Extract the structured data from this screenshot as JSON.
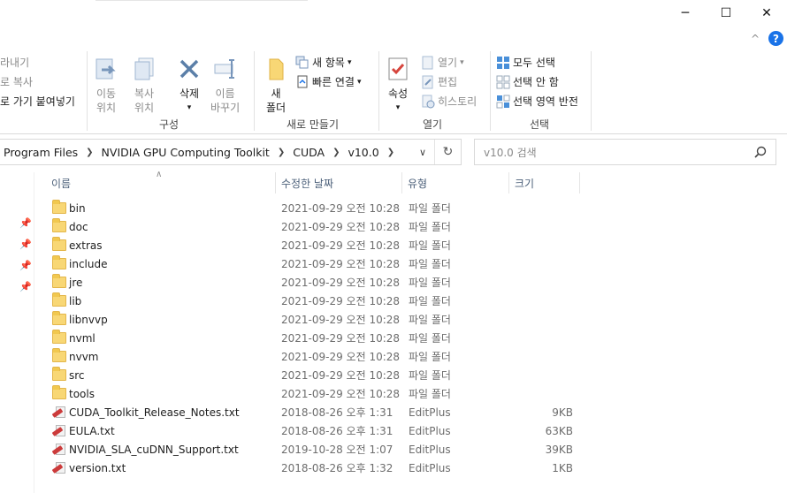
{
  "window": {
    "controls": {
      "minimize": "─",
      "maximize": "☐",
      "close": "✕"
    }
  },
  "ribbon": {
    "collapse_icon": "^",
    "help_label": "?",
    "clipboard": {
      "items": [
        "라내기",
        "로 복사",
        "로 가기 붙여넣기"
      ]
    },
    "organize": {
      "label": "구성",
      "move_to": [
        "이동",
        "위치"
      ],
      "copy_to": [
        "복사",
        "위치"
      ],
      "delete": "삭제",
      "rename": [
        "이름",
        "바꾸기"
      ]
    },
    "new": {
      "label": "새로 만들기",
      "new_folder": [
        "새",
        "폴더"
      ],
      "new_item": "새 항목",
      "easy_access": "빠른 연결"
    },
    "open": {
      "label": "열기",
      "properties": "속성",
      "open": "열기",
      "edit": "편집",
      "history": "히스토리"
    },
    "select": {
      "label": "선택",
      "select_all": "모두 선택",
      "select_none": "선택 안 함",
      "invert_selection": "선택 영역 반전"
    }
  },
  "address": {
    "crumbs": [
      "Program Files",
      "NVIDIA GPU Computing Toolkit",
      "CUDA",
      "v10.0"
    ],
    "search_placeholder": "v10.0 검색"
  },
  "columns": {
    "name": "이름",
    "date": "수정한 날짜",
    "type": "유형",
    "size": "크기"
  },
  "files": [
    {
      "name": "bin",
      "date": "2021-09-29 오전 10:28",
      "type": "파일 폴더",
      "size": "",
      "kind": "folder"
    },
    {
      "name": "doc",
      "date": "2021-09-29 오전 10:28",
      "type": "파일 폴더",
      "size": "",
      "kind": "folder"
    },
    {
      "name": "extras",
      "date": "2021-09-29 오전 10:28",
      "type": "파일 폴더",
      "size": "",
      "kind": "folder"
    },
    {
      "name": "include",
      "date": "2021-09-29 오전 10:28",
      "type": "파일 폴더",
      "size": "",
      "kind": "folder"
    },
    {
      "name": "jre",
      "date": "2021-09-29 오전 10:28",
      "type": "파일 폴더",
      "size": "",
      "kind": "folder"
    },
    {
      "name": "lib",
      "date": "2021-09-29 오전 10:28",
      "type": "파일 폴더",
      "size": "",
      "kind": "folder"
    },
    {
      "name": "libnvvp",
      "date": "2021-09-29 오전 10:28",
      "type": "파일 폴더",
      "size": "",
      "kind": "folder"
    },
    {
      "name": "nvml",
      "date": "2021-09-29 오전 10:28",
      "type": "파일 폴더",
      "size": "",
      "kind": "folder"
    },
    {
      "name": "nvvm",
      "date": "2021-09-29 오전 10:28",
      "type": "파일 폴더",
      "size": "",
      "kind": "folder"
    },
    {
      "name": "src",
      "date": "2021-09-29 오전 10:28",
      "type": "파일 폴더",
      "size": "",
      "kind": "folder"
    },
    {
      "name": "tools",
      "date": "2021-09-29 오전 10:28",
      "type": "파일 폴더",
      "size": "",
      "kind": "folder"
    },
    {
      "name": "CUDA_Toolkit_Release_Notes.txt",
      "date": "2018-08-26 오후 1:31",
      "type": "EditPlus",
      "size": "9KB",
      "kind": "txt"
    },
    {
      "name": "EULA.txt",
      "date": "2018-08-26 오후 1:31",
      "type": "EditPlus",
      "size": "63KB",
      "kind": "txt"
    },
    {
      "name": "NVIDIA_SLA_cuDNN_Support.txt",
      "date": "2019-10-28 오전 1:07",
      "type": "EditPlus",
      "size": "39KB",
      "kind": "txt"
    },
    {
      "name": "version.txt",
      "date": "2018-08-26 오후 1:32",
      "type": "EditPlus",
      "size": "1KB",
      "kind": "txt"
    }
  ]
}
